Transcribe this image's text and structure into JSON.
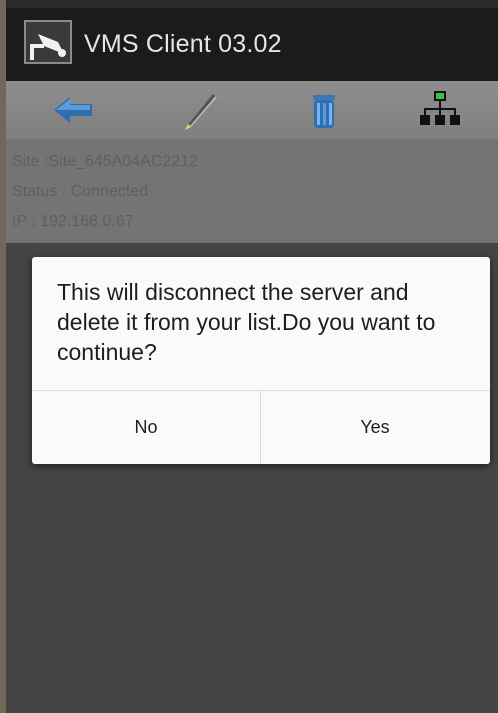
{
  "app": {
    "title": "VMS Client 03.02"
  },
  "toolbar": {
    "buttons": [
      {
        "name": "back",
        "icon": "back-arrow-icon"
      },
      {
        "name": "edit",
        "icon": "pencil-icon"
      },
      {
        "name": "delete",
        "icon": "trash-icon"
      },
      {
        "name": "network",
        "icon": "network-icon"
      }
    ]
  },
  "site_info": {
    "site": "Site :Site_645A04AC2212",
    "status": "Status : Connected",
    "ip": "IP : 192.168.0.67"
  },
  "dialog": {
    "message": "This will disconnect the server and delete it from your list.Do you want to continue?",
    "no_label": "No",
    "yes_label": "Yes"
  }
}
